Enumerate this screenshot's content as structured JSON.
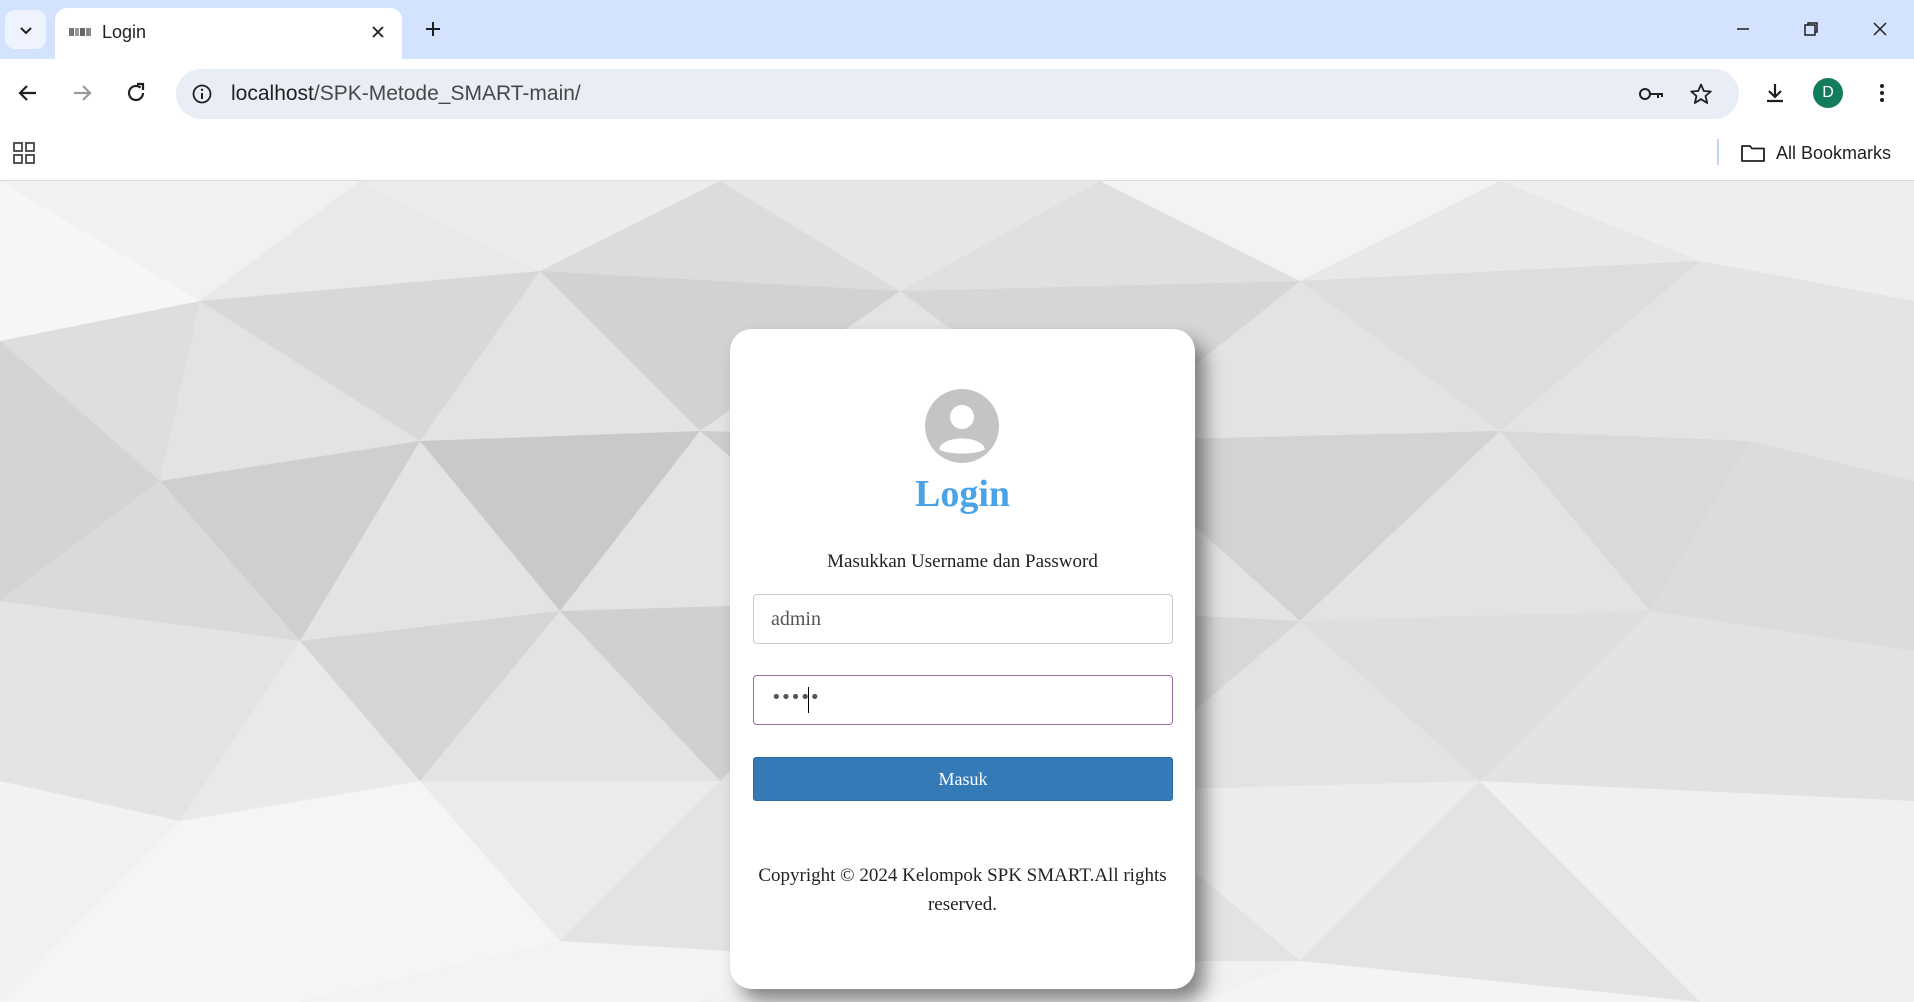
{
  "browser": {
    "tab_title": "Login",
    "url_host": "localhost",
    "url_path": "/SPK-Metode_SMART-main/",
    "profile_initial": "D",
    "all_bookmarks_label": "All Bookmarks",
    "icons": {
      "tab_search": "chevron-down-icon",
      "close_tab": "close-icon",
      "new_tab": "plus-icon",
      "back": "back-arrow-icon",
      "forward": "forward-arrow-icon",
      "reload": "reload-icon",
      "site_info": "info-icon",
      "password_manager": "key-icon",
      "bookmark_star": "star-icon",
      "downloads": "download-icon",
      "menu": "kebab-menu-icon",
      "apps": "apps-grid-icon",
      "folder": "folder-icon"
    },
    "colors": {
      "tabstrip": "#d3e3fd",
      "omnibox": "#e9eef6",
      "avatar": "#137c5c"
    }
  },
  "login": {
    "title": "Login",
    "subtitle": "Masukkan Username dan Password",
    "username_value": "admin",
    "password_masked": "•••••",
    "submit_label": "Masuk",
    "copyright": "Copyright © 2024 Kelompok SPK SMART.All rights reserved.",
    "colors": {
      "title": "#4aa3e6",
      "button": "#337ab7"
    }
  }
}
